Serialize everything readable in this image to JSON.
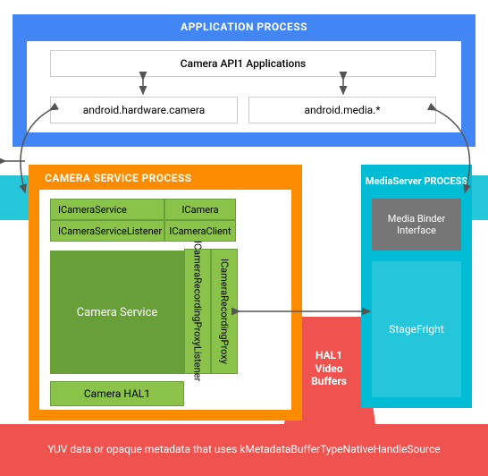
{
  "app": {
    "title": "APPLICATION PROCESS",
    "api_box": "Camera API1 Applications",
    "hw_camera": "android.hardware.camera",
    "media": "android.media.*"
  },
  "csp": {
    "title": "CAMERA SERVICE PROCESS",
    "ics": "ICameraService",
    "icam": "ICamera",
    "icsl": "ICameraServiceListener",
    "icc": "ICameraClient",
    "cservice": "Camera Service",
    "icrpl": "ICameraRecordingProxyListener",
    "icrp": "ICameraRecordingProxy",
    "hal1": "Camera HAL1"
  },
  "ms": {
    "title": "MediaServer PROCESS",
    "mbi": "Media Binder Interface",
    "sf": "StageFright"
  },
  "hal_buffers": "HAL1 Video Buffers",
  "footer": "YUV data or opaque metadata that uses kMetadataBufferTypeNativeHandleSource"
}
